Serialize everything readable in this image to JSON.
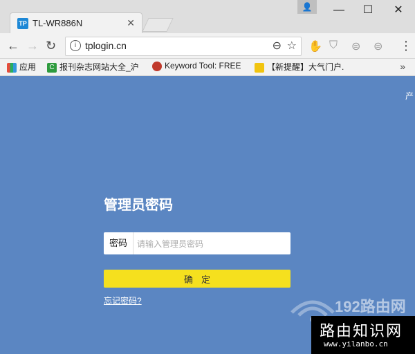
{
  "window": {
    "tab_title": "TL-WR886N",
    "tab_favicon_text": "TP"
  },
  "toolbar": {
    "url": "tplogin.cn"
  },
  "bookmarks": [
    {
      "label": "应用"
    },
    {
      "label": "报刊杂志网站大全_沪"
    },
    {
      "label": "Keyword Tool: FREE"
    },
    {
      "label": "【新提醒】大气门户."
    }
  ],
  "page": {
    "corner_text": "产",
    "title": "管理员密码",
    "password_label": "密码",
    "password_placeholder": "请输入管理员密码",
    "confirm_label": "确定",
    "forgot_link": "忘记密码?"
  },
  "watermark": {
    "logo_text": "192路由网",
    "big_text": "路由知识网",
    "small_text": "www.yilanbo.cn"
  },
  "colors": {
    "page_bg": "#5b86c2",
    "confirm_bg": "#f5e01e"
  }
}
